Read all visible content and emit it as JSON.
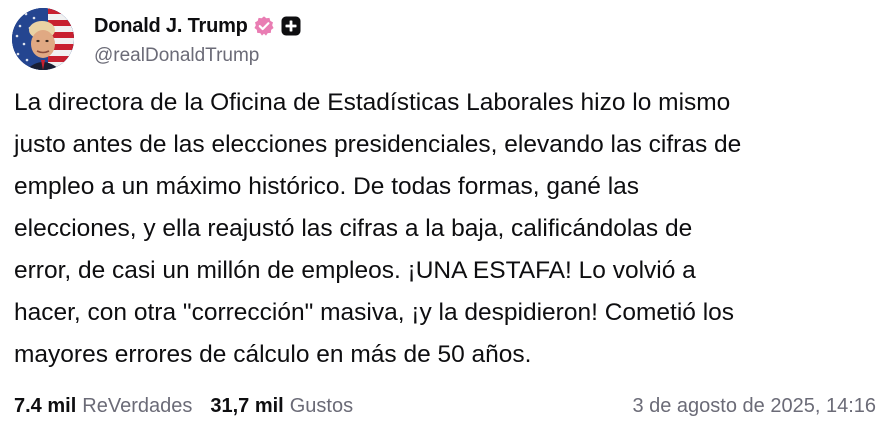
{
  "author": {
    "display_name": "Donald J. Trump",
    "handle": "@realDonaldTrump",
    "avatar_icon": "avatar-flag-portrait",
    "badge_icon": "verified-badge-icon",
    "badge_color": "#e97db3",
    "subscribe_icon": "plus-icon"
  },
  "post": {
    "text": "La directora de la Oficina de Estadísticas Laborales hizo lo mismo\njusto antes de las elecciones presidenciales, elevando las cifras de\nempleo a un máximo histórico. De todas formas, gané las\nelecciones, y ella reajustó las cifras a la baja, calificándolas de\nerror, de casi un millón de empleos. ¡UNA ESTAFA! Lo volvió a\nhacer, con otra \"corrección\" masiva, ¡y la despidieron! Cometió los\nmayores errores de cálculo en más de 50 años."
  },
  "stats": {
    "reposts_count": "7.4 mil",
    "reposts_label": "ReVerdades",
    "likes_count": "31,7 mil",
    "likes_label": "Gustos",
    "timestamp": "3 de agosto de 2025, 14:16"
  }
}
